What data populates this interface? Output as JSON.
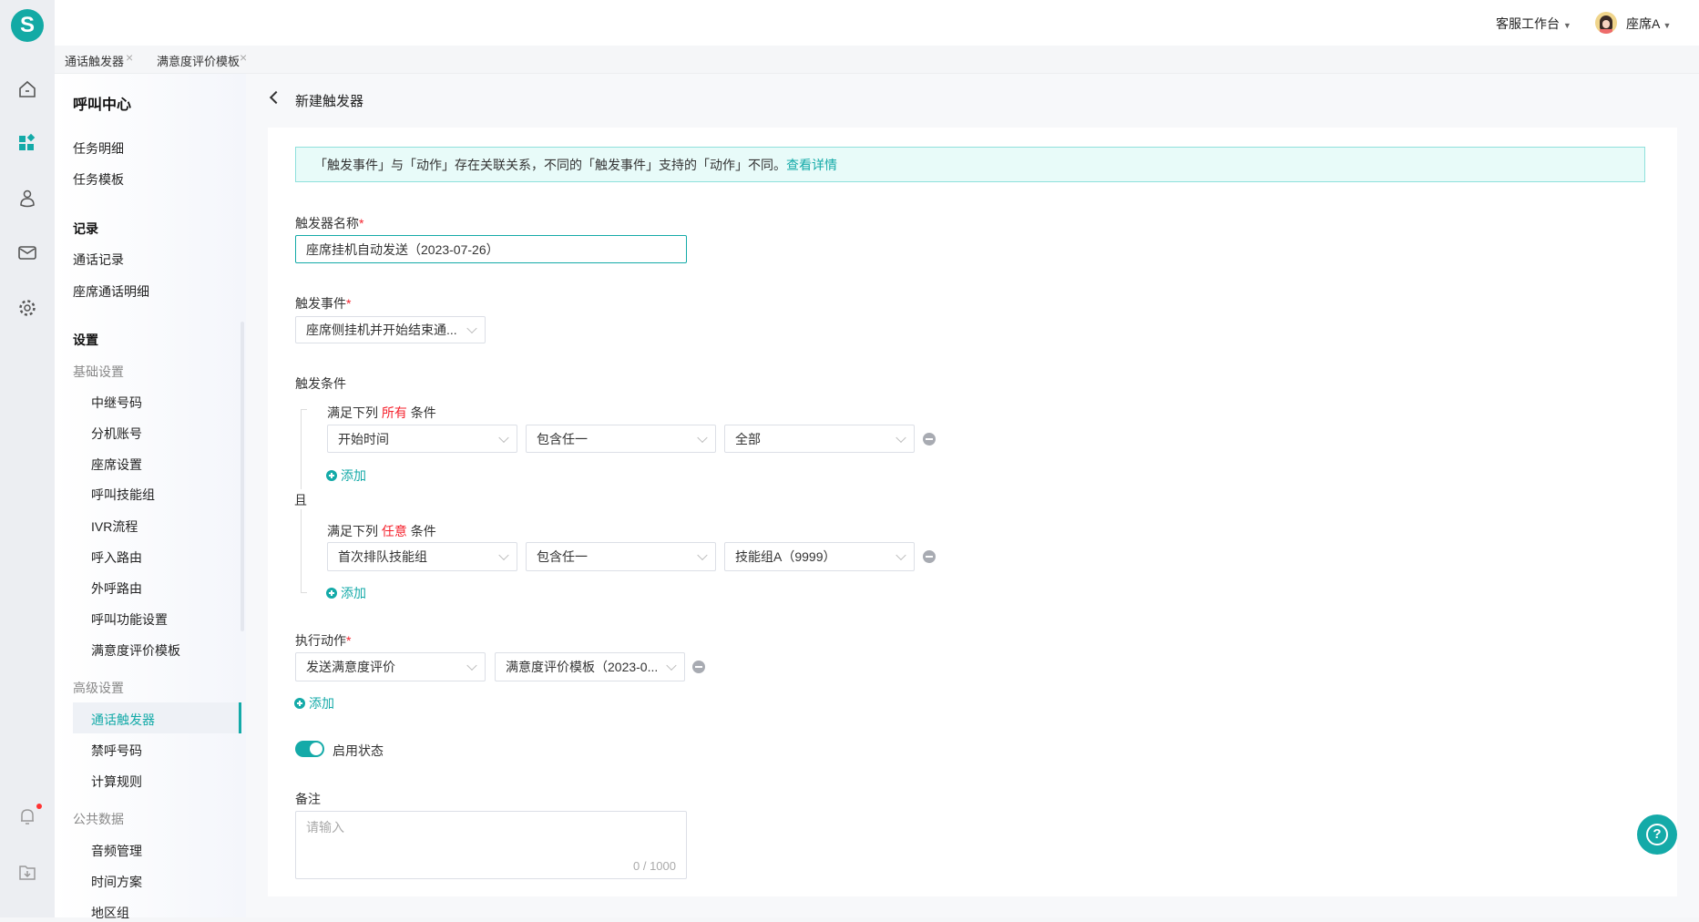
{
  "colors": {
    "accent": "#14aaa8",
    "required": "#f5222d",
    "alert_bg": "#e8fbf9"
  },
  "rail": {
    "logo": "S",
    "icons": [
      "home-icon",
      "apps-icon",
      "agent-icon",
      "mail-icon",
      "gear-icon",
      "bell-icon",
      "download-folder-icon"
    ],
    "notification_dot": true
  },
  "topbar": {
    "workspace": "客服工作台",
    "user": "座席A"
  },
  "tabs": [
    {
      "label": "通话触发器"
    },
    {
      "label": "满意度评价模板"
    }
  ],
  "sidebar": {
    "title": "呼叫中心",
    "items": [
      "任务明细",
      "任务模板"
    ],
    "records_head": "记录",
    "records": [
      "通话记录",
      "座席通话明细"
    ],
    "settings_head": "设置",
    "basic_group": "基础设置",
    "basic": [
      "中继号码",
      "分机账号",
      "座席设置",
      "呼叫技能组",
      "IVR流程",
      "呼入路由",
      "外呼路由",
      "呼叫功能设置",
      "满意度评价模板"
    ],
    "advanced_group": "高级设置",
    "advanced": [
      "通话触发器",
      "禁呼号码",
      "计算规则"
    ],
    "advanced_active": "通话触发器",
    "public_group": "公共数据",
    "public": [
      "音频管理",
      "时间方案",
      "地区组"
    ]
  },
  "page": {
    "title": "新建触发器"
  },
  "alert": {
    "text": "「触发事件」与「动作」存在关联关系，不同的「触发事件」支持的「动作」不同。",
    "link": "查看详情"
  },
  "form": {
    "name_label": "触发器名称",
    "name_value": "座席挂机自动发送（2023-07-26）",
    "event_label": "触发事件",
    "event_value": "座席侧挂机并开始结束通...",
    "cond_label": "触发条件",
    "and_label": "且",
    "group1": {
      "prefix": "满足下列",
      "mode": "所有",
      "suffix": "条件",
      "row": [
        "开始时间",
        "包含任一",
        "全部"
      ],
      "add": "添加"
    },
    "group2": {
      "prefix": "满足下列",
      "mode": "任意",
      "suffix": "条件",
      "row": [
        "首次排队技能组",
        "包含任一",
        "技能组A（9999）"
      ],
      "add": "添加"
    },
    "action_label": "执行动作",
    "action": [
      "发送满意度评价",
      "满意度评价模板（2023-0..."
    ],
    "action_add": "添加",
    "enabled_label": "启用状态",
    "enabled": true,
    "remark_label": "备注",
    "remark_placeholder": "请输入",
    "remark_count": "0 / 1000",
    "required_mark": "*"
  }
}
